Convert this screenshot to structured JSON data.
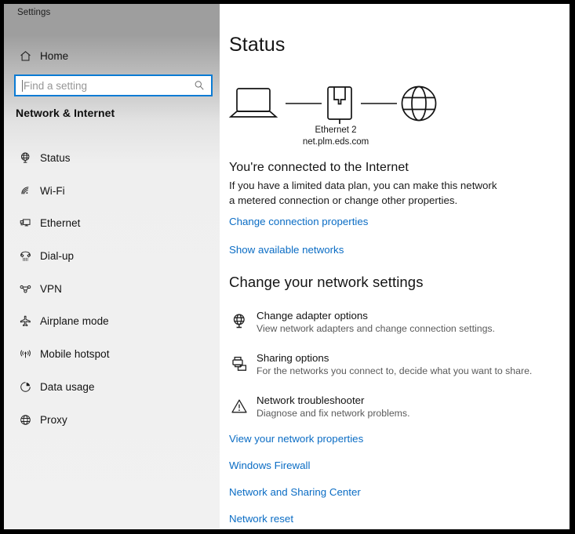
{
  "window": {
    "app_title": "Settings"
  },
  "sidebar": {
    "home_label": "Home",
    "home_icon": "home-icon",
    "search": {
      "placeholder": "Find a setting",
      "icon": "search-icon",
      "value": ""
    },
    "category_title": "Network & Internet",
    "items": [
      {
        "label": "Status",
        "icon": "status-globe-icon",
        "selected": true
      },
      {
        "label": "Wi-Fi",
        "icon": "wifi-icon",
        "selected": false
      },
      {
        "label": "Ethernet",
        "icon": "ethernet-icon",
        "selected": false
      },
      {
        "label": "Dial-up",
        "icon": "dialup-phone-icon",
        "selected": false
      },
      {
        "label": "VPN",
        "icon": "vpn-icon",
        "selected": false
      },
      {
        "label": "Airplane mode",
        "icon": "airplane-icon",
        "selected": false
      },
      {
        "label": "Mobile hotspot",
        "icon": "hotspot-icon",
        "selected": false
      },
      {
        "label": "Data usage",
        "icon": "pie-chart-icon",
        "selected": false
      },
      {
        "label": "Proxy",
        "icon": "globe-icon",
        "selected": false
      }
    ]
  },
  "main": {
    "page_title": "Status",
    "diagram": {
      "device_icon": "laptop-icon",
      "adapter_icon": "ethernet-port-icon",
      "internet_icon": "globe-icon",
      "adapter_name": "Ethernet 2",
      "network_name": "net.plm.eds.com"
    },
    "connection": {
      "heading": "You're connected to the Internet",
      "description": "If you have a limited data plan, you can make this network a metered connection or change other properties.",
      "links": [
        {
          "label": "Change connection properties"
        },
        {
          "label": "Show available networks"
        }
      ]
    },
    "network_settings": {
      "heading": "Change your network settings",
      "items": [
        {
          "title": "Change adapter options",
          "subtitle": "View network adapters and change connection settings.",
          "icon": "adapter-globe-icon"
        },
        {
          "title": "Sharing options",
          "subtitle": "For the networks you connect to, decide what you want to share.",
          "icon": "sharing-printer-icon"
        },
        {
          "title": "Network troubleshooter",
          "subtitle": "Diagnose and fix network problems.",
          "icon": "warning-triangle-icon"
        }
      ]
    },
    "footer_links": [
      {
        "label": "View your network properties"
      },
      {
        "label": "Windows Firewall"
      },
      {
        "label": "Network and Sharing Center"
      },
      {
        "label": "Network reset"
      }
    ]
  },
  "colors": {
    "accent_blue": "#0a6cc4",
    "focus_border": "#0a7bd4",
    "sidebar_top": "#9e9e9e",
    "sidebar_bottom": "#f1f1f1"
  }
}
